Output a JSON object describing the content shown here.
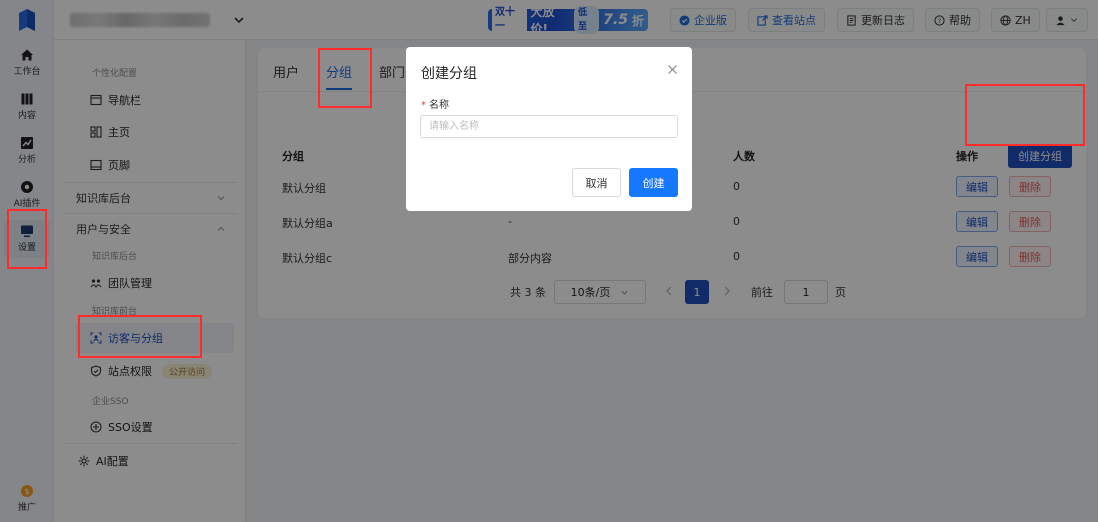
{
  "rail": {
    "items": [
      {
        "label": "工作台",
        "icon": "home-icon"
      },
      {
        "label": "内容",
        "icon": "content-icon"
      },
      {
        "label": "分析",
        "icon": "chart-icon"
      },
      {
        "label": "AI插件",
        "icon": "plugin-icon"
      },
      {
        "label": "设置",
        "icon": "monitor-icon"
      },
      {
        "label": "推广",
        "icon": "coin-icon"
      }
    ]
  },
  "header": {
    "promo": {
      "tag": "双十一",
      "main": "大放价!",
      "sub": "低至",
      "discount": "7.5",
      "unit": "折"
    },
    "buttons": {
      "enterprise": "企业版",
      "view_site": "查看站点",
      "changelog": "更新日志",
      "help": "帮助",
      "lang": "ZH"
    }
  },
  "sidebar": {
    "personalization": "个性化配置",
    "navbar": "导航栏",
    "home": "主页",
    "footer": "页脚",
    "kb_backend": "知识库后台",
    "user_security": "用户与安全",
    "sub_kb_backend": "知识库后台",
    "team": "团队管理",
    "sub_kb_frontend": "知识库前台",
    "visitors_groups": "访客与分组",
    "site_permission": "站点权限",
    "public_access": "公开访问",
    "enterprise_sso": "企业SSO",
    "sso_settings": "SSO设置",
    "ai_config": "AI配置"
  },
  "main": {
    "tabs": [
      "用户",
      "分组",
      "部门"
    ],
    "create_group": "创建分组",
    "columns": {
      "group": "分组",
      "content": "",
      "count": "人数",
      "actions": "操作"
    },
    "rows": [
      {
        "name": "默认分组",
        "content": "",
        "count": "0"
      },
      {
        "name": "默认分组a",
        "content": "-",
        "count": "0"
      },
      {
        "name": "默认分组c",
        "content": "部分内容",
        "count": "0"
      }
    ],
    "edit": "编辑",
    "delete": "删除",
    "pagination": {
      "total": "共 3 条",
      "page_size": "10条/页",
      "current": "1",
      "goto": "前往",
      "goto_value": "1",
      "page_unit": "页"
    }
  },
  "modal": {
    "title": "创建分组",
    "field_label": "名称",
    "required_mark": "*",
    "placeholder": "请输入名称",
    "cancel": "取消",
    "confirm": "创建"
  },
  "colors": {
    "accent": "#1f4fbf",
    "primary": "#1677ff",
    "danger": "#e65a5a",
    "annotation": "#ff2a2a"
  }
}
